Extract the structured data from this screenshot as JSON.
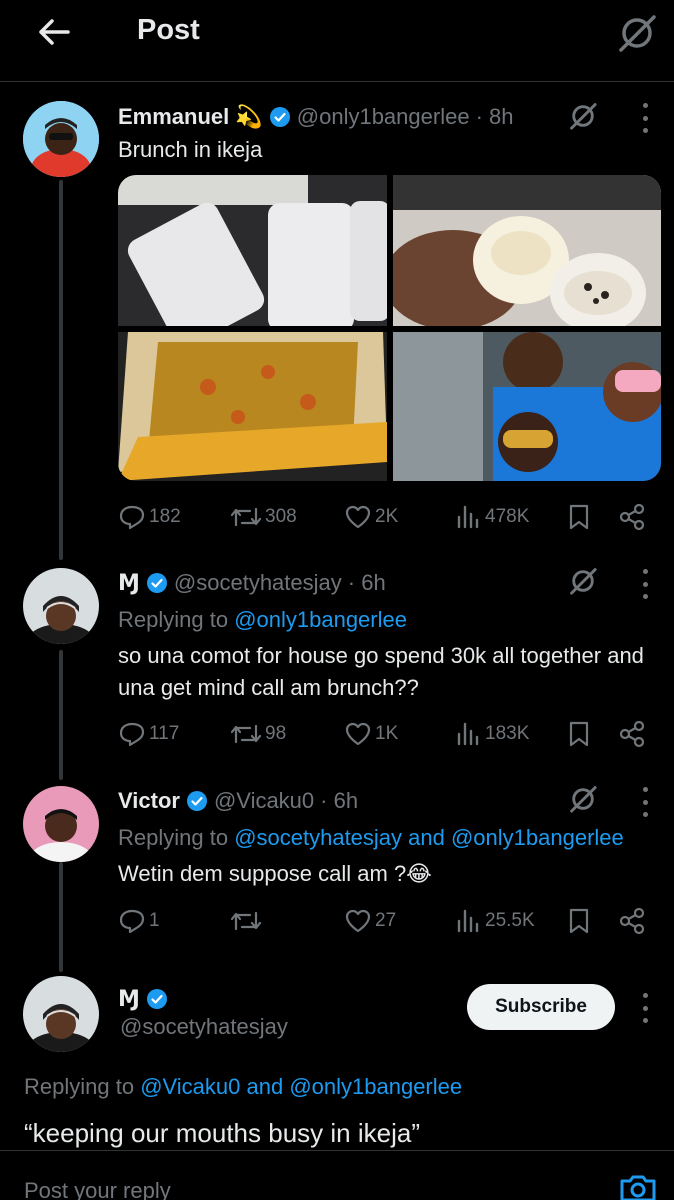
{
  "header": {
    "title": "Post"
  },
  "posts": [
    {
      "name": "Emmanuel 💫",
      "handle": "@only1bangerlee",
      "time": "· 8h",
      "text": "Brunch in ikeja",
      "stats": {
        "replies": "182",
        "reposts": "308",
        "likes": "2K",
        "views": "478K"
      }
    },
    {
      "name": "Ɱ",
      "handle": "@socetyhatesjay",
      "time": "· 6h",
      "replying_prefix": "Replying to ",
      "replying_to": "@only1bangerlee",
      "text": "so una comot for house go spend 30k all together and una get mind call am brunch??",
      "stats": {
        "replies": "117",
        "reposts": "98",
        "likes": "1K",
        "views": "183K"
      }
    },
    {
      "name": "Victor",
      "handle": "@Vicaku0",
      "time": "· 6h",
      "replying_prefix": "Replying to ",
      "replying_to": "@socetyhatesjay and @only1bangerlee",
      "text": "Wetin dem suppose call am ?😂",
      "stats": {
        "replies": "1",
        "reposts": "",
        "likes": "27",
        "views": "25.5K"
      }
    }
  ],
  "focused": {
    "name": "Ɱ",
    "handle": "@socetyhatesjay",
    "subscribe_label": "Subscribe",
    "replying_prefix": "Replying to ",
    "replying_to": "@Vicaku0 and @only1bangerlee",
    "text": "“keeping our mouths busy in ikeja”"
  },
  "composer": {
    "placeholder": "Post your reply"
  },
  "colors": {
    "accent": "#1d9bf0",
    "muted": "#71767b",
    "background": "#000000",
    "text": "#e7e9ea"
  },
  "icons": [
    "back-arrow-icon",
    "grok-icon",
    "verified-badge-icon",
    "more-icon",
    "reply-icon",
    "repost-icon",
    "like-icon",
    "views-icon",
    "bookmark-icon",
    "share-icon",
    "camera-icon"
  ]
}
